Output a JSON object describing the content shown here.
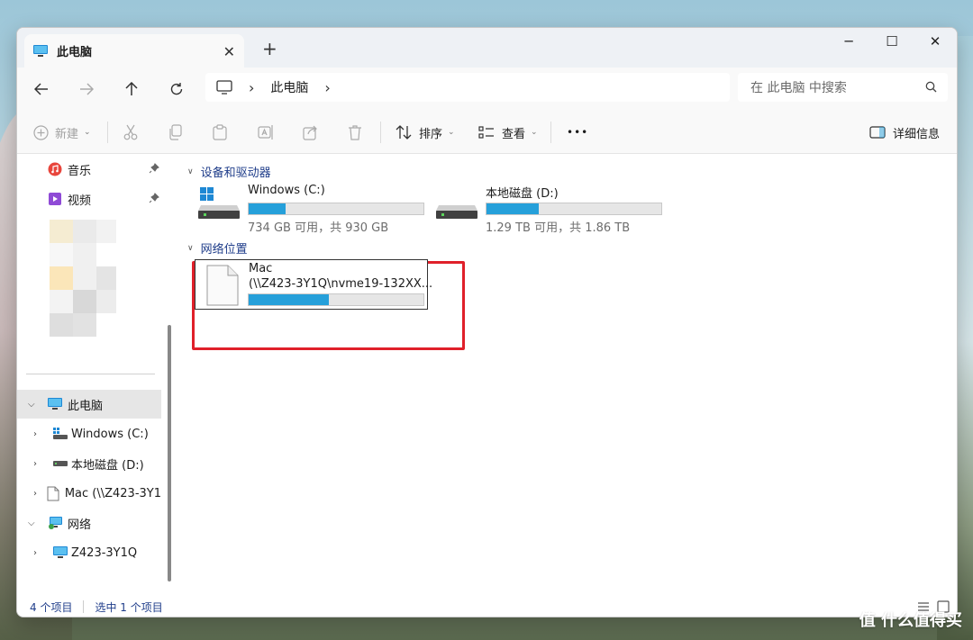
{
  "window": {
    "tab_title": "此电脑",
    "new_tab": "+",
    "controls": {
      "minimize": "─",
      "maximize": "☐",
      "close": "✕"
    }
  },
  "navigation": {
    "breadcrumb": [
      "此电脑"
    ],
    "search_placeholder": "在 此电脑 中搜索"
  },
  "toolbar": {
    "new_label": "新建",
    "sort_label": "排序",
    "view_label": "查看",
    "more_label": "•••",
    "details_label": "详细信息"
  },
  "sidebar": {
    "quick_access": [
      {
        "label": "音乐",
        "icon": "music-icon",
        "pinned": true
      },
      {
        "label": "视频",
        "icon": "video-icon",
        "pinned": true
      }
    ],
    "this_pc": {
      "label": "此电脑",
      "icon": "monitor-icon",
      "expanded": true
    },
    "this_pc_children": [
      {
        "label": "Windows (C:)",
        "icon": "windows-drive-icon"
      },
      {
        "label": "本地磁盘 (D:)",
        "icon": "drive-icon"
      },
      {
        "label": "Mac (\\\\Z423-3Y1",
        "icon": "file-icon"
      }
    ],
    "network": {
      "label": "网络",
      "icon": "network-icon",
      "expanded": true
    },
    "network_children": [
      {
        "label": "Z423-3Y1Q",
        "icon": "monitor-icon"
      }
    ]
  },
  "content": {
    "devices_header": "设备和驱动器",
    "drives": [
      {
        "name": "Windows (C:)",
        "info": "734 GB 可用，共 930 GB",
        "used_fraction": 0.21
      },
      {
        "name": "本地磁盘 (D:)",
        "info": "1.29 TB 可用，共 1.86 TB",
        "used_fraction": 0.3
      }
    ],
    "network_header": "网络位置",
    "network_location": {
      "name": "Mac",
      "path": "(\\\\Z423-3Y1Q\\nvme19-132XX...",
      "used_fraction": 0.46
    }
  },
  "status": {
    "item_count": "4 个项目",
    "selected": "选中 1 个项目"
  },
  "watermark": "值 什么值得买",
  "colors": {
    "accent": "#26a0da",
    "highlight": "#e0202a",
    "link": "#1f3d8a"
  }
}
